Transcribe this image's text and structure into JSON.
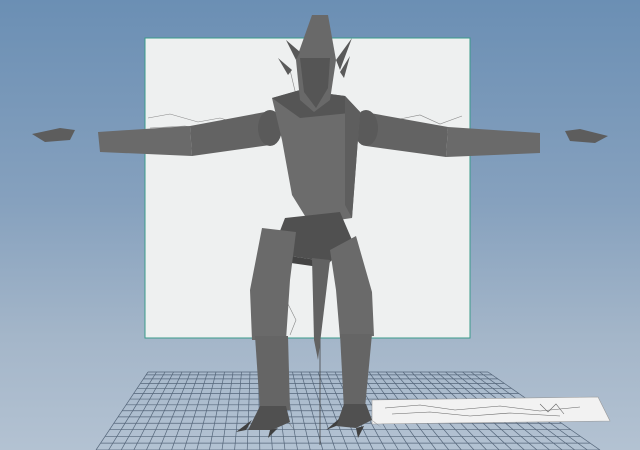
{
  "app": {
    "type": "3d-viewport"
  },
  "viewport": {
    "background_top": "#6b8fb4",
    "background_bottom": "#b3c2d2",
    "grid_color": "#55667a",
    "model_color": "#6e6e6e",
    "reference_plane_color": "#eef0f0"
  },
  "scene": {
    "model": "character-low-poly-t-pose",
    "reference_image": "front-view-sketch",
    "ground_grid": true
  }
}
